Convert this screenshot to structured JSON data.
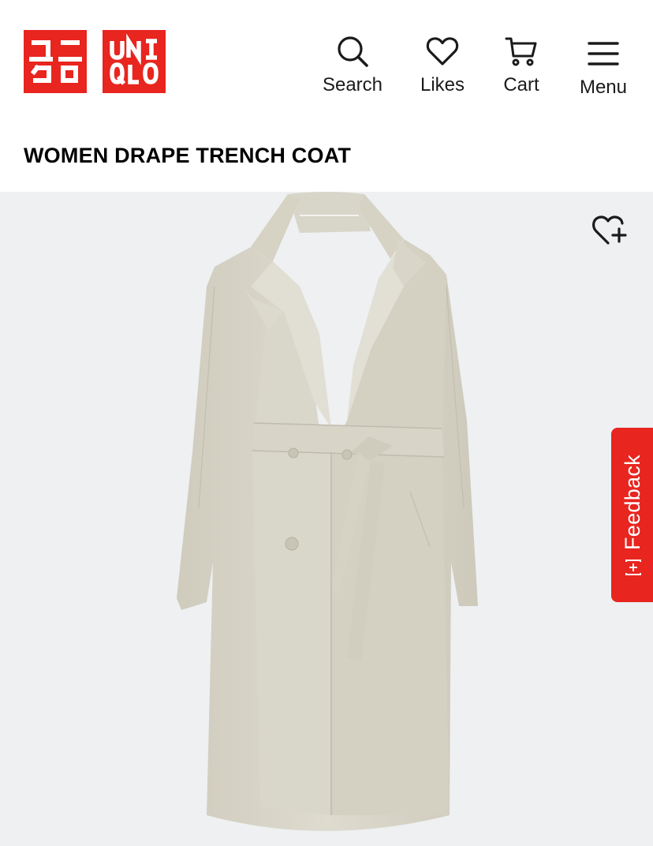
{
  "brand": {
    "logo_katakana": "ユニクロ",
    "logo_latin_line1": "UNI",
    "logo_latin_line2": "QLO",
    "color": "#e8251f"
  },
  "nav": {
    "search": {
      "label": "Search",
      "icon": "search-icon"
    },
    "likes": {
      "label": "Likes",
      "icon": "heart-icon"
    },
    "cart": {
      "label": "Cart",
      "icon": "cart-icon"
    },
    "menu": {
      "label": "Menu",
      "icon": "hamburger-menu-icon"
    }
  },
  "product": {
    "title": "WOMEN DRAPE TRENCH COAT",
    "image": "beige-belted-trench-coat",
    "wishlist_icon": "heart-plus-icon"
  },
  "feedback": {
    "label": "Feedback",
    "icon": "feedback-plus-icon"
  }
}
